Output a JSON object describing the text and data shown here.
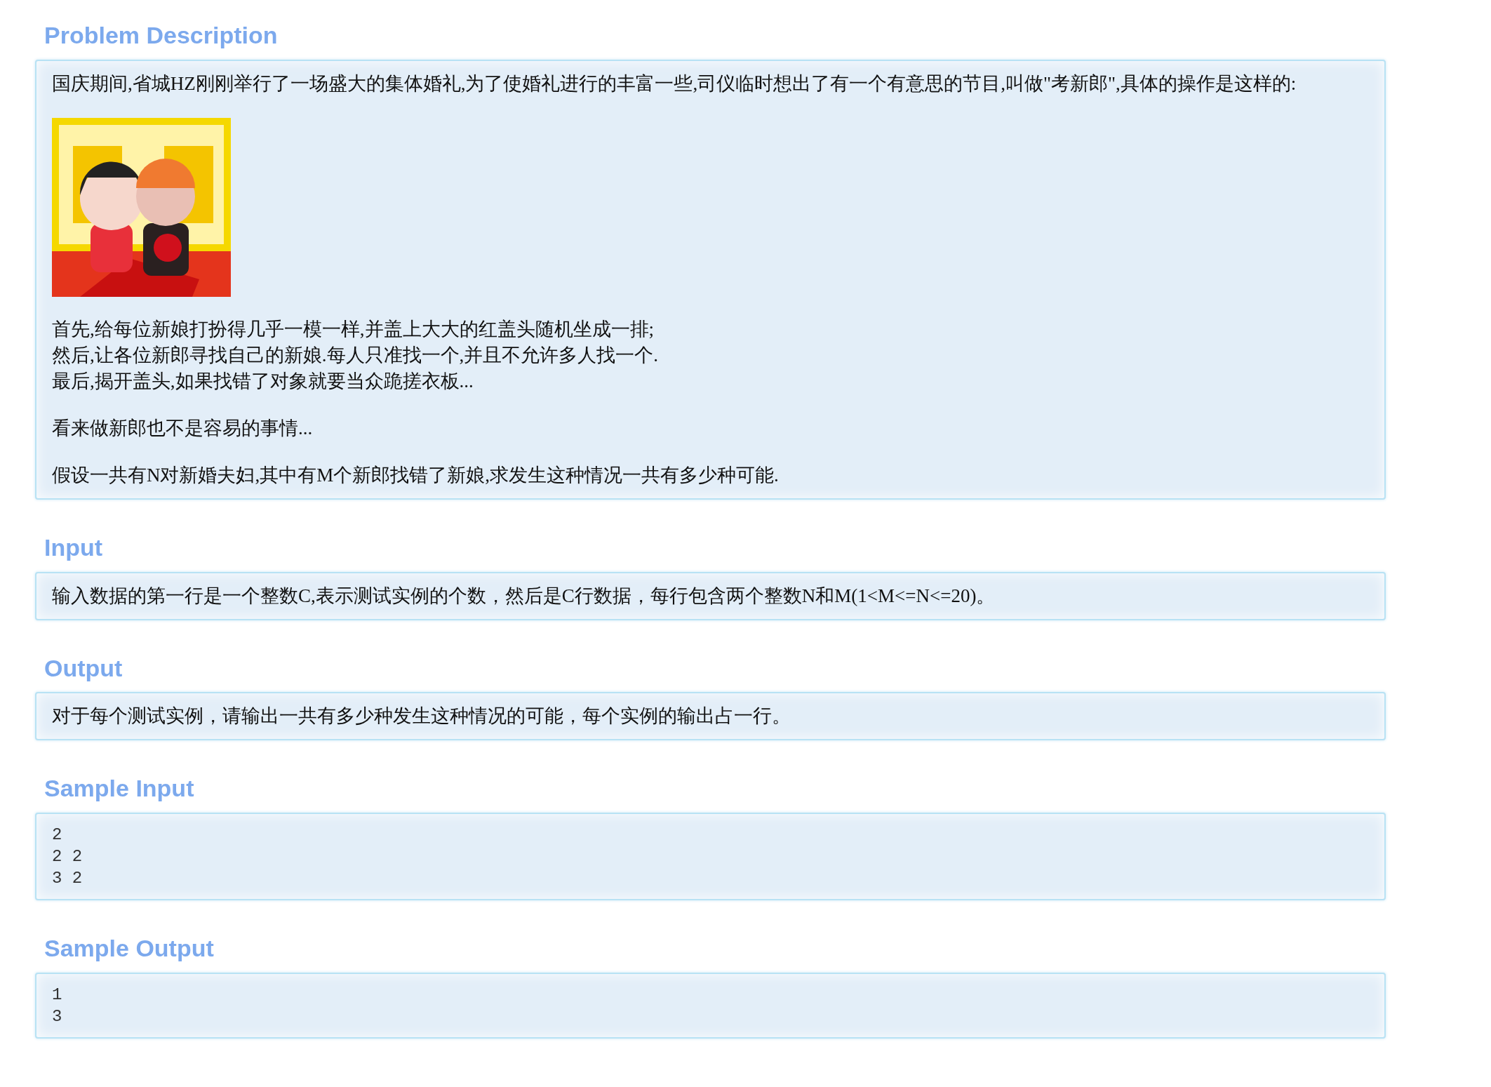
{
  "sections": [
    {
      "title": "Problem Description",
      "blocks": [
        {
          "kind": "text",
          "lines": [
            "国庆期间,省城HZ刚刚举行了一场盛大的集体婚礼,为了使婚礼进行的丰富一些,司仪临时想出了有一个有意思的节目,叫做\"考新郎\",具体的操作是这样的:"
          ]
        },
        {
          "kind": "picture"
        },
        {
          "kind": "text",
          "lines": [
            "首先,给每位新娘打扮得几乎一模一样,并盖上大大的红盖头随机坐成一排;",
            "然后,让各位新郎寻找自己的新娘.每人只准找一个,并且不允许多人找一个.",
            "最后,揭开盖头,如果找错了对象就要当众跪搓衣板..."
          ]
        },
        {
          "kind": "text",
          "lines": [
            "看来做新郎也不是容易的事情..."
          ]
        },
        {
          "kind": "text",
          "lines": [
            "假设一共有N对新婚夫妇,其中有M个新郎找错了新娘,求发生这种情况一共有多少种可能."
          ]
        }
      ]
    },
    {
      "title": "Input",
      "blocks": [
        {
          "kind": "text",
          "lines": [
            "输入数据的第一行是一个整数C,表示测试实例的个数，然后是C行数据，每行包含两个整数N和M(1<M<=N<=20)。"
          ]
        }
      ]
    },
    {
      "title": "Output",
      "blocks": [
        {
          "kind": "text",
          "lines": [
            "对于每个测试实例，请输出一共有多少种发生这种情况的可能，每个实例的输出占一行。"
          ]
        }
      ]
    },
    {
      "title": "Sample Input",
      "blocks": [
        {
          "kind": "code",
          "lines": [
            "2",
            "2 2",
            "3 2"
          ]
        }
      ]
    },
    {
      "title": "Sample Output",
      "blocks": [
        {
          "kind": "code",
          "lines": [
            "1",
            "3"
          ]
        }
      ]
    }
  ]
}
